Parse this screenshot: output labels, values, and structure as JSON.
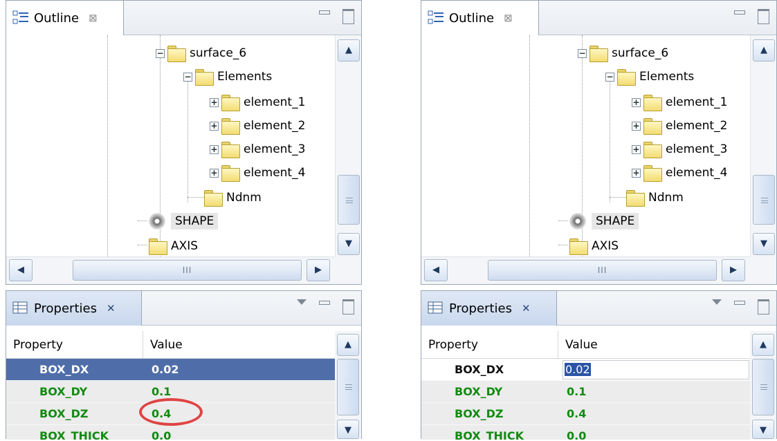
{
  "outline": {
    "tab_label": "Outline",
    "close_glyph": "⊠",
    "tree": [
      {
        "label": "surface_6",
        "expander": "−"
      },
      {
        "label": "Elements",
        "expander": "−"
      },
      {
        "label": "element_1",
        "expander": "+"
      },
      {
        "label": "element_2",
        "expander": "+"
      },
      {
        "label": "element_3",
        "expander": "+"
      },
      {
        "label": "element_4",
        "expander": "+"
      },
      {
        "label": "Ndnm"
      },
      {
        "label": "SHAPE"
      },
      {
        "label": "AXIS"
      }
    ],
    "hscroll_grip": "III"
  },
  "properties": {
    "tab_label": "Properties",
    "close_glyph": "✕",
    "columns": {
      "property": "Property",
      "value": "Value"
    },
    "rows": [
      {
        "name": "BOX_DX",
        "value": "0.02"
      },
      {
        "name": "BOX_DY",
        "value": "0.1"
      },
      {
        "name": "BOX_DZ",
        "value": "0.4"
      },
      {
        "name": "BOX_THICK",
        "value": "0.0"
      }
    ]
  },
  "colors": {
    "selection": "#4f6ea9",
    "property_text": "#128a12",
    "annotation_circle": "#e04444"
  },
  "icons": {
    "outline": "outline-view-icon",
    "properties": "properties-view-icon",
    "folder": "folder-icon",
    "shape": "shape-icon"
  }
}
